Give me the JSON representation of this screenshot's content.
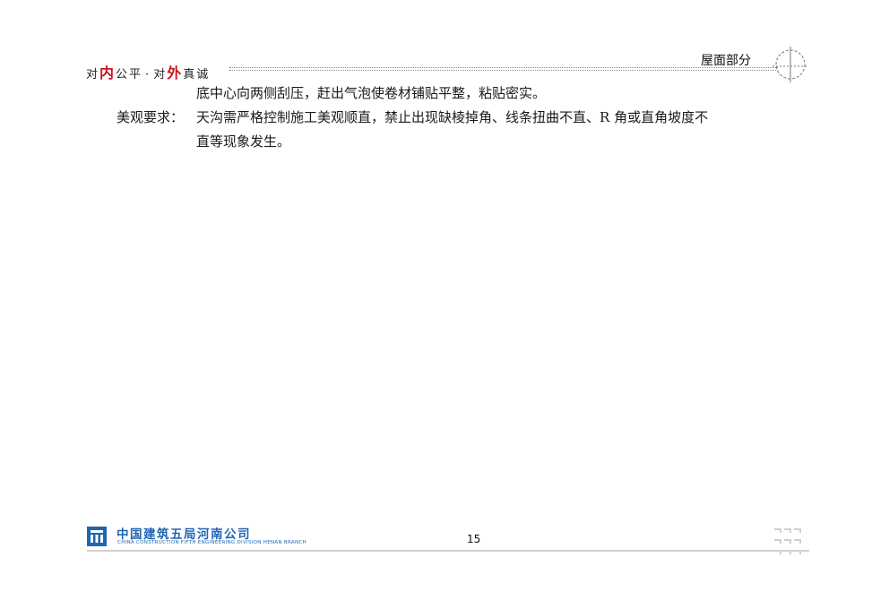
{
  "header": {
    "slogan_parts": [
      "对",
      "内",
      "公平",
      "·",
      "对",
      "外",
      "真诚"
    ],
    "section_title": "屋面部分"
  },
  "content": {
    "line1": "底中心向两侧刮压，赶出气泡使卷材铺贴平整，粘贴密实。",
    "line2_label": "美观要求：",
    "line2_text": "天沟需严格控制施工美观顺直，禁止出现缺棱掉角、线条扭曲不直、R 角或直角坡度不",
    "line3": "直等现象发生。"
  },
  "footer": {
    "company_name": "中国建筑五局河南公司",
    "company_english": "CHINA CONSTRUCTION FIFTH ENGINEERING DIVISION HENAN BRANCH",
    "page_number": "15"
  },
  "colors": {
    "brand_blue": "#1f65b5",
    "accent_red": "#c8161d",
    "rule_gray": "#d0d0d0"
  },
  "icons": {
    "header_mark": "crosshair-circle-icon",
    "logo": "company-logo-icon",
    "footer_deco": "decorative-corner-icon"
  }
}
